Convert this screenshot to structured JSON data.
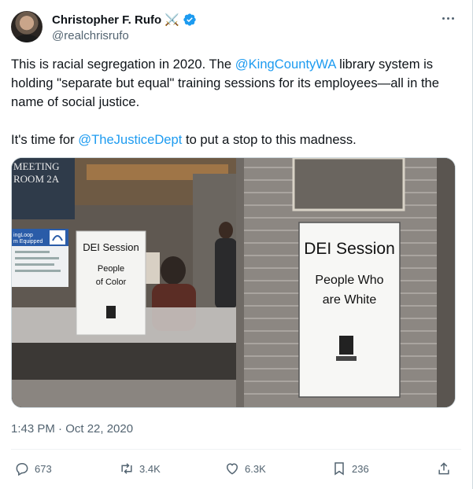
{
  "author": {
    "display_name": "Christopher F. Rufo",
    "name_emoji": "⚔️",
    "handle": "@realchrisrufo",
    "verified_color": "#1d9bf0"
  },
  "tweet": {
    "para1_pre": "This is racial segregation in 2020. The ",
    "para1_mention": "@KingCountyWA",
    "para1_post": " library system is holding \"separate but equal\" training sessions for its employees—all in the name of social justice.",
    "para2_pre": "It's time for ",
    "para2_mention": "@TheJusticeDept",
    "para2_post": " to put a stop to this madness.",
    "timestamp": "1:43 PM · Oct 22, 2020"
  },
  "media": {
    "room_sign_line1": "MEETING",
    "room_sign_line2": "ROOM 2A",
    "loop_sign_line1": "ingLoop",
    "loop_sign_line2": "m Equipped",
    "sign_left_title": "DEI Session",
    "sign_left_line1": "People",
    "sign_left_line2": "of Color",
    "sign_right_title": "DEI Session",
    "sign_right_line1": "People Who",
    "sign_right_line2": "are White"
  },
  "actions": {
    "replies": "673",
    "reposts": "3.4K",
    "likes": "6.3K",
    "bookmarks": "236"
  },
  "colors": {
    "text": "#0f1419",
    "secondary": "#536471",
    "link": "#1d9bf0"
  }
}
